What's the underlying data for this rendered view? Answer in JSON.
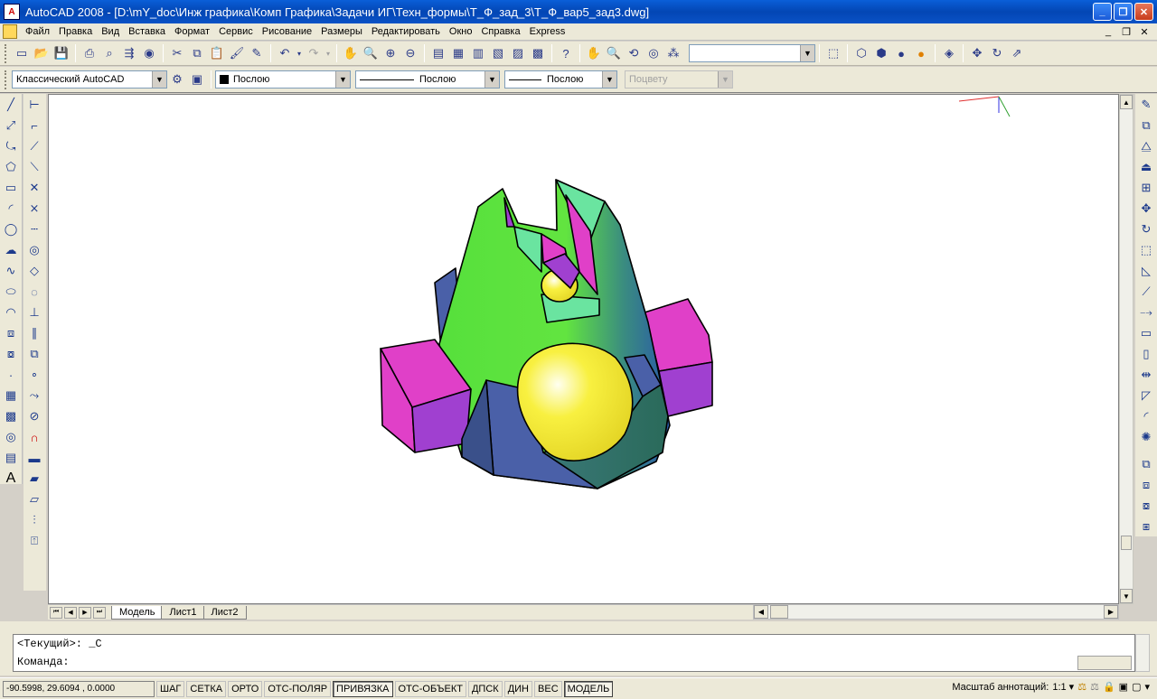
{
  "window": {
    "title": "AutoCAD 2008 - [D:\\mY_doc\\Инж графика\\Комп Графика\\Задачи ИГ\\Техн_формы\\Т_Ф_зад_3\\Т_Ф_вар5_зад3.dwg]"
  },
  "menu": [
    "Файл",
    "Правка",
    "Вид",
    "Вставка",
    "Формат",
    "Сервис",
    "Рисование",
    "Размеры",
    "Редактировать",
    "Окно",
    "Справка",
    "Express"
  ],
  "toolbar2": {
    "workspace": "Классический AutoCAD",
    "color": "Послою",
    "linetype": "Послою",
    "lineweight": "Послою",
    "plotstyle": "Поцвету"
  },
  "tabs": {
    "model": "Модель",
    "layout1": "Лист1",
    "layout2": "Лист2"
  },
  "command": {
    "line1": "<Текущий>: _C",
    "line2": "Команда:"
  },
  "status": {
    "coords": "-90.5998, 29.6094 , 0.0000",
    "toggles": [
      "ШАГ",
      "СЕТКА",
      "ОРТО",
      "ОТС-ПОЛЯР",
      "ПРИВЯЗКА",
      "ОТС-ОБЪЕКТ",
      "ДПСК",
      "ДИН",
      "ВЕС",
      "МОДЕЛЬ"
    ],
    "anno_label": "Масштаб аннотаций:",
    "anno_scale": "1:1 ▾"
  },
  "colors": {
    "green": "#62e440",
    "magenta": "#e040c8",
    "slate": "#4a60a8",
    "yellow": "#f8f040",
    "mint": "#6ae4a0",
    "purple": "#a040d0"
  }
}
